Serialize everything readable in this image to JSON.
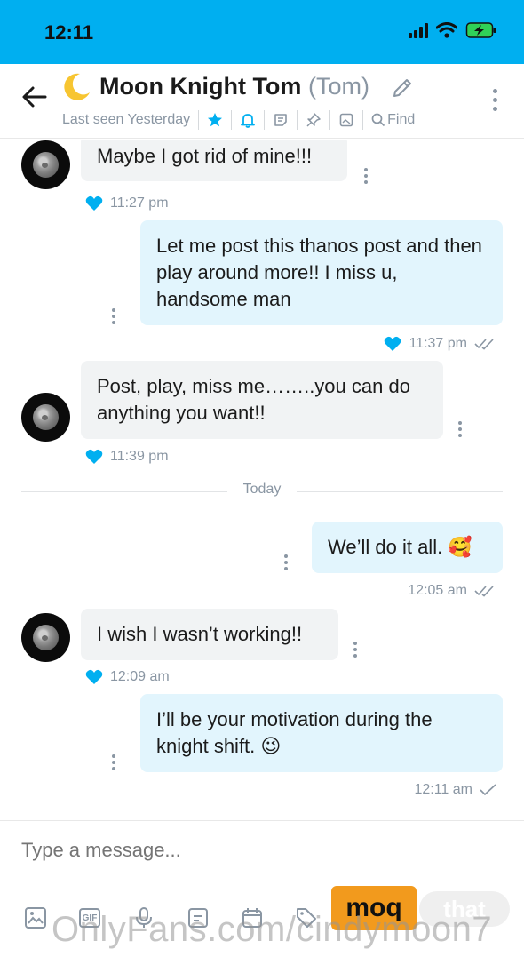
{
  "status_bar": {
    "time": "12:11"
  },
  "header": {
    "title": "Moon Knight Tom",
    "alias": "(Tom)",
    "last_seen": "Last seen Yesterday",
    "find_label": "Find"
  },
  "messages": [
    {
      "dir": "in",
      "text": "Maybe I got rid of mine!!!",
      "time": "11:27 pm",
      "liked": true
    },
    {
      "dir": "out",
      "text": "Let me post this thanos post and then play around more!! I miss u, handsome man",
      "time": "11:37 pm",
      "liked": true,
      "status": "read"
    },
    {
      "dir": "in",
      "text": "Post, play, miss me……..you can do anything you want!!",
      "time": "11:39 pm",
      "liked": true
    },
    {
      "dir": "out",
      "text": "We’ll do it all. 🥰",
      "time": "12:05 am",
      "liked": false,
      "status": "read"
    },
    {
      "dir": "in",
      "text": "I wish I wasn’t working!!",
      "time": "12:09 am",
      "liked": true
    },
    {
      "dir": "out",
      "text": "I’ll be your motivation during the knight shift. 😉",
      "time": "12:11 am",
      "liked": false,
      "status": "sent"
    }
  ],
  "day_divider": "Today",
  "composer": {
    "placeholder": "Type a message...",
    "tools": [
      "image-icon",
      "gif-icon",
      "microphone-icon",
      "vault-icon",
      "calendar-icon",
      "price-tag-icon"
    ],
    "gif_label": "GIF"
  },
  "overlay": {
    "badge_text": "moq",
    "ghost_text": "that",
    "watermark": "OnlyFans.com/cindymoon7"
  },
  "colors": {
    "accent": "#00aff0",
    "incoming_bubble": "#f1f3f4",
    "outgoing_bubble": "#e2f5fd",
    "muted": "#8a96a3",
    "heart": "#00aff0",
    "badge": "#f29a1d"
  }
}
